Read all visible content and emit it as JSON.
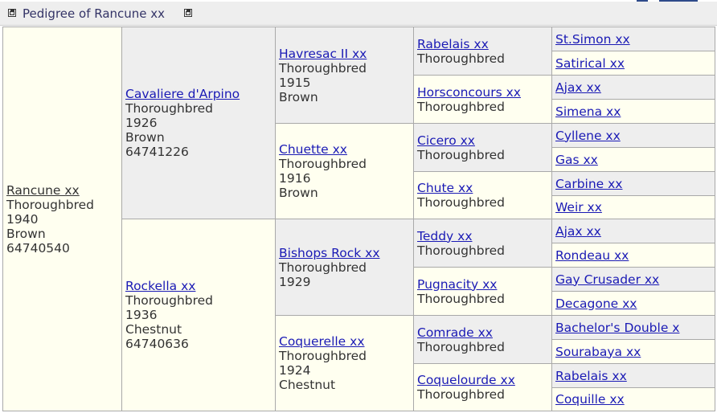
{
  "title": "Pedigree of Rancune xx",
  "subject": {
    "name": "Rancune xx",
    "breed": "Thoroughbred",
    "year": "1940",
    "color": "Brown",
    "id": "64740540"
  },
  "sire": {
    "name": "Cavaliere d'Arpino",
    "breed": "Thoroughbred",
    "year": "1926",
    "color": "Brown",
    "id": "64741226"
  },
  "dam": {
    "name": "Rockella xx",
    "breed": "Thoroughbred",
    "year": "1936",
    "color": "Chestnut",
    "id": "64740636"
  },
  "gen3": [
    {
      "name": "Havresac II xx",
      "breed": "Thoroughbred",
      "year": "1915",
      "color": "Brown"
    },
    {
      "name": "Chuette xx",
      "breed": "Thoroughbred",
      "year": "1916",
      "color": "Brown"
    },
    {
      "name": "Bishops Rock xx",
      "breed": "Thoroughbred",
      "year": "1929"
    },
    {
      "name": "Coquerelle xx",
      "breed": "Thoroughbred",
      "year": "1924",
      "color": "Chestnut"
    }
  ],
  "gen4": [
    {
      "name": "Rabelais xx",
      "breed": "Thoroughbred"
    },
    {
      "name": "Horsconcours xx",
      "breed": "Thoroughbred"
    },
    {
      "name": "Cicero xx",
      "breed": "Thoroughbred"
    },
    {
      "name": "Chute xx",
      "breed": "Thoroughbred"
    },
    {
      "name": "Teddy xx",
      "breed": "Thoroughbred"
    },
    {
      "name": "Pugnacity xx",
      "breed": "Thoroughbred"
    },
    {
      "name": "Comrade xx",
      "breed": "Thoroughbred"
    },
    {
      "name": "Coquelourde xx",
      "breed": "Thoroughbred"
    }
  ],
  "gen5": [
    "St.Simon xx",
    "Satirical xx",
    "Ajax xx",
    "Simena xx",
    "Cyllene xx",
    "Gas xx",
    "Carbine xx",
    "Weir xx",
    "Ajax xx",
    "Rondeau xx",
    "Gay Crusader xx",
    "Decagone xx",
    "Bachelor's Double x",
    "Sourabaya xx",
    "Rabelais xx",
    "Coquille xx"
  ]
}
